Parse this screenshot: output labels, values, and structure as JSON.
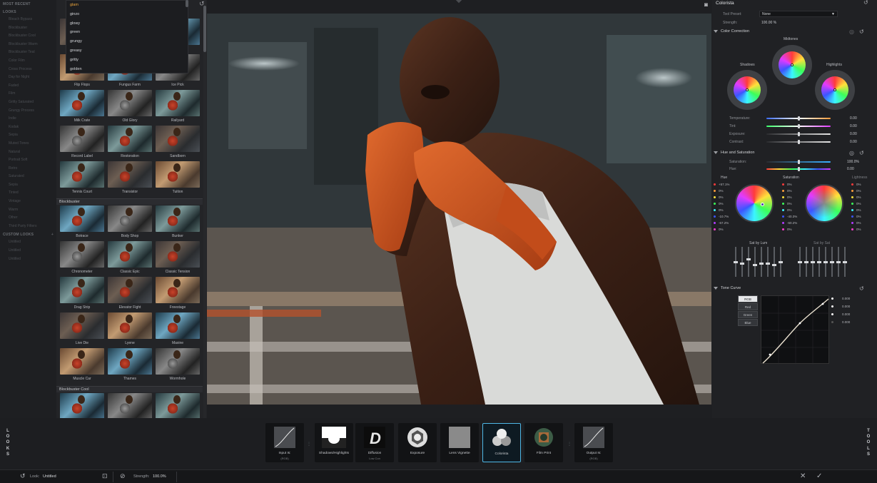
{
  "sidebar": {
    "most_recent": "MOST RECENT",
    "looks": "LOOKS",
    "items": [
      "Bleach Bypass",
      "Blockbuster",
      "Blockbuster Cool",
      "Blockbuster Warm",
      "Blockbuster Teal",
      "Color Film",
      "Cross Process",
      "Day for Night",
      "Faded",
      "Film",
      "Gritty Saturated",
      "Grungy Process",
      "Indie",
      "Kodak",
      "Sepia",
      "Muted Tones",
      "Natural",
      "Portrait Soft",
      "Retro",
      "Saturated",
      "Sepia",
      "Tinted",
      "Vintage",
      "Warm",
      "Other",
      "Third Party Filters"
    ],
    "custom_looks": "CUSTOM LOOKS",
    "custom_items": [
      "Untitled",
      "Untitled",
      "Untitled"
    ]
  },
  "dropdown": {
    "options": [
      "glam",
      "ginzo",
      "glowy",
      "green",
      "grungy",
      "greasy",
      "gritty",
      "golden"
    ],
    "selected": "glam"
  },
  "looks_grid": {
    "rows_top": [
      [
        "Flip Flops",
        "Fungus Farm",
        "Ice Pick"
      ],
      [
        "Milk Crate",
        "Old Glory",
        "Railyard"
      ],
      [
        "Record Label",
        "Restoration",
        "Sandborn"
      ],
      [
        "Tennis Court",
        "Transistor",
        "Tuition"
      ]
    ],
    "group_blockbuster": "Blockbuster",
    "rows_blockbuster": [
      [
        "Botrace",
        "Body Shop",
        "Bunker"
      ],
      [
        "Chronometer",
        "Classic Epic",
        "Classic Tension"
      ],
      [
        "Drag Strip",
        "Elevator Fight",
        "Freestage"
      ],
      [
        "Live Die",
        "Lyene",
        "Maxine"
      ],
      [
        "Muscle Car",
        "Thames",
        "Wormhole"
      ]
    ],
    "group_blockbuster_cool": "Blockbuster Cool"
  },
  "right_panel": {
    "title": "Colorista",
    "tool_preset_label": "Tool Preset:",
    "tool_preset_value": "None",
    "strength_label": "Strength:",
    "strength_value": "100.00 %",
    "color_correction": "Color Correction",
    "midtones": "Midtones",
    "shadows": "Shadows",
    "highlights": "Highlights",
    "cc_sliders": [
      {
        "label": "Temperature:",
        "value": "0.00"
      },
      {
        "label": "Tint:",
        "value": "0.00"
      },
      {
        "label": "Exposure:",
        "value": "0.00"
      },
      {
        "label": "Contrast:",
        "value": "0.00"
      }
    ],
    "hue_saturation": "Hue and Saturation",
    "hs_sliders": [
      {
        "label": "Saturation:",
        "value": "100.0%"
      },
      {
        "label": "Hue:",
        "value": "0.00"
      }
    ],
    "hue_col": "Hue",
    "sat_col": "Saturation",
    "light_col": "Lightness",
    "hue_values": [
      "+57.1%",
      "0%",
      "0%",
      "0%",
      "0%",
      "-10.7%",
      "-67.2%",
      "0%"
    ],
    "sat_values": [
      "0%",
      "0%",
      "0%",
      "0%",
      "0%",
      "-40.3%",
      "-60.2%",
      "0%"
    ],
    "light_values": [
      "0%",
      "0%",
      "0%",
      "0%",
      "0%",
      "0%",
      "0%",
      "0%"
    ],
    "sat_by_lum": "Sat by Lum",
    "sat_by_sat": "Sat by Sat",
    "tone_curve": "Tone Curve",
    "curve_channels": [
      "RGB",
      "Red",
      "Green",
      "Blue"
    ],
    "curve_values": [
      "0.000",
      "0.000",
      "0.000",
      "0.000"
    ]
  },
  "pipeline": {
    "looks_vertical": "LOOKS",
    "tools_vertical": "TOOLS",
    "nodes": [
      {
        "label": "Input Is:",
        "sub": "(RGB)"
      },
      {
        "label": "Shadows/Highlights",
        "sub": ""
      },
      {
        "label": "Diffusion",
        "sub": "Low Con"
      },
      {
        "label": "Exposure",
        "sub": ""
      },
      {
        "label": "Lens Vignette",
        "sub": ""
      },
      {
        "label": "Colorista",
        "sub": ""
      },
      {
        "label": "Film Print",
        "sub": ""
      },
      {
        "label": "Output Is:",
        "sub": "(RGB)"
      }
    ]
  },
  "status": {
    "look_label": "Look:",
    "look_value": "Untitled",
    "strength_label": "Strength:",
    "strength_value": "100.0%"
  },
  "colors": {
    "accent": "#4fb7e6",
    "selected_option": "#e8a33b",
    "glove": "#d65a23"
  }
}
